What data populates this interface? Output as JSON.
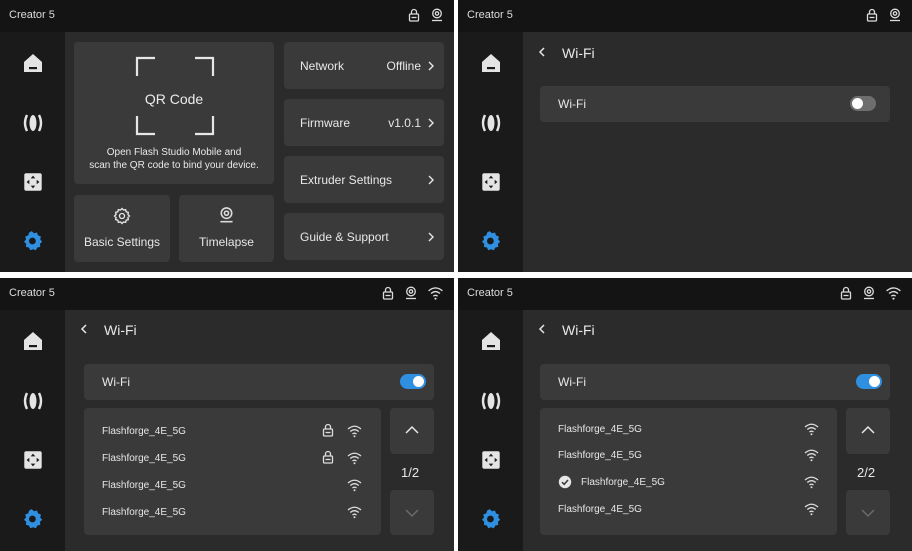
{
  "brand": "Creator 5",
  "colors": {
    "accent": "#2f8fe0",
    "toggle_off": "#6e6e6e",
    "bg": "#2b2b2b",
    "card": "#3a3a3a",
    "sidebar": "#1a1a1a",
    "topbar": "#141414"
  },
  "nav_icons": [
    "home-icon",
    "filament-icon",
    "move-axis-icon",
    "settings-gear-icon"
  ],
  "panel1": {
    "qr": {
      "title": "QR Code",
      "line1": "Open Flash Studio Mobile  and",
      "line2": "scan the QR code to bind your device."
    },
    "basic_settings": "Basic Settings",
    "timelapse": "Timelapse",
    "menu": [
      {
        "label": "Network",
        "value": "Offline"
      },
      {
        "label": "Firmware",
        "value": "v1.0.1"
      },
      {
        "label": "Extruder Settings",
        "value": ""
      },
      {
        "label": "Guide & Support",
        "value": ""
      }
    ]
  },
  "panel2": {
    "title": "Wi-Fi",
    "wifi_label": "Wi-Fi",
    "wifi_on": false
  },
  "panel3": {
    "title": "Wi-Fi",
    "wifi_label": "Wi-Fi",
    "wifi_on": true,
    "networks": [
      {
        "name": "Flashforge_4E_5G",
        "locked": true
      },
      {
        "name": "Flashforge_4E_5G",
        "locked": true
      },
      {
        "name": "Flashforge_4E_5G",
        "locked": false
      },
      {
        "name": "Flashforge_4E_5G",
        "locked": false
      }
    ],
    "page": "1/2"
  },
  "panel4": {
    "title": "Wi-Fi",
    "wifi_label": "Wi-Fi",
    "wifi_on": true,
    "networks": [
      {
        "name": "Flashforge_4E_5G",
        "connected": false
      },
      {
        "name": "Flashforge_4E_5G",
        "connected": false
      },
      {
        "name": "Flashforge_4E_5G",
        "connected": true
      },
      {
        "name": "Flashforge_4E_5G",
        "connected": false
      }
    ],
    "page": "2/2"
  }
}
